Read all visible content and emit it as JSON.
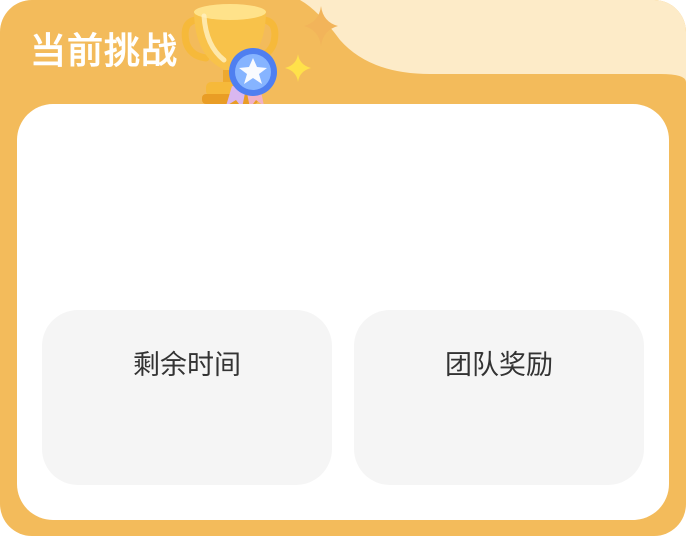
{
  "header": {
    "title": "当前挑战",
    "trophy_icon": "trophy-medal-icon",
    "sparkle_icon": "sparkle-icon"
  },
  "stats": [
    {
      "label": "剩余时间"
    },
    {
      "label": "团队奖励"
    }
  ],
  "colors": {
    "accent": "#f3bb5b",
    "header_light": "#fdebc8",
    "panel": "#ffffff",
    "stat_bg": "#f5f5f5",
    "text": "#333333"
  }
}
